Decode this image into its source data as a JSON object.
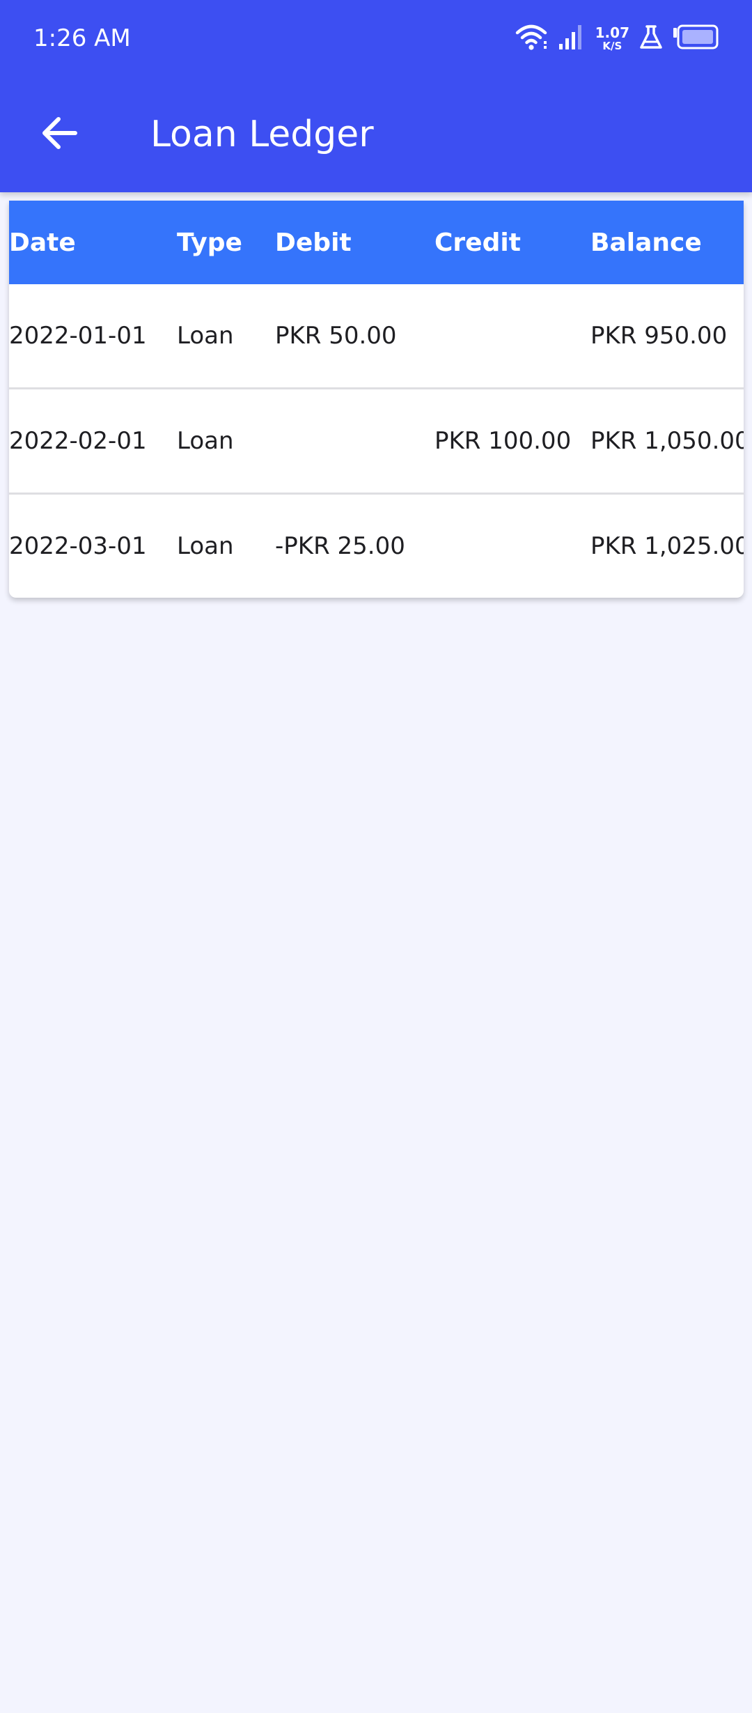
{
  "status_bar": {
    "time": "1:26 AM",
    "net_speed_value": "1.07",
    "net_speed_unit": "K/S",
    "icons": [
      "wifi-icon",
      "signal-icon",
      "lab-flask-icon",
      "battery-icon"
    ]
  },
  "app_bar": {
    "title": "Loan Ledger",
    "back_icon": "arrow-left-icon"
  },
  "ledger": {
    "columns": [
      "Date",
      "Type",
      "Debit",
      "Credit",
      "Balance"
    ],
    "rows": [
      {
        "date": "2022-01-01",
        "type": "Loan",
        "debit": "PKR 50.00",
        "credit": "",
        "balance": "PKR 950.00"
      },
      {
        "date": "2022-02-01",
        "type": "Loan",
        "debit": "",
        "credit": "PKR 100.00",
        "balance": "PKR 1,050.00"
      },
      {
        "date": "2022-03-01",
        "type": "Loan",
        "debit": "-PKR 25.00",
        "credit": "",
        "balance": "PKR 1,025.00"
      }
    ]
  },
  "colors": {
    "app_bar": "#3d4ff2",
    "table_header": "#3574fb",
    "background": "#f3f4fe",
    "card": "#ffffff",
    "text": "#1e1e22"
  }
}
